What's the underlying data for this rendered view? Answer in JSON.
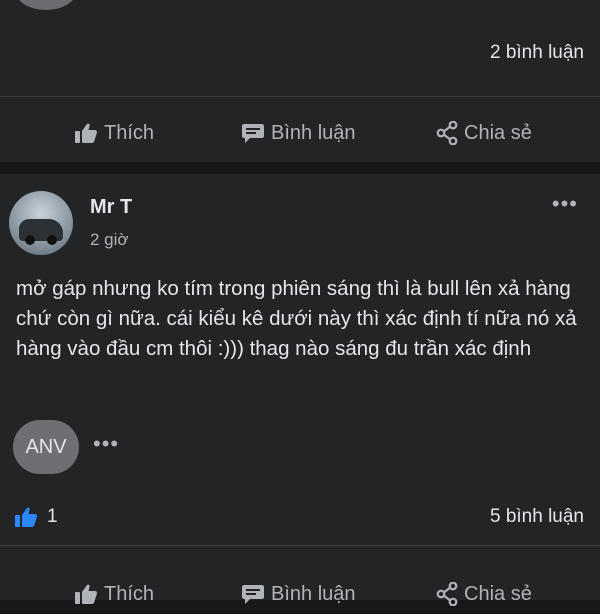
{
  "previous_post": {
    "comments_count": "2 bình luận",
    "actions": {
      "like_label": "Thích",
      "comment_label": "Bình luận",
      "share_label": "Chia sẻ"
    }
  },
  "post": {
    "author": "Mr T",
    "time": "2 giờ",
    "text": "mở gáp nhưng ko tím trong phiên sáng thì là bull lên xả hàng chứ còn gì nữa.  cái kiểu kê dưới này thì xác định tí nữa nó xả hàng vào đầu cm thôi :))) thag nào sáng đu trần xác định",
    "commenter_initials": "ANV",
    "like_count": "1",
    "comments_count": "5 bình luận",
    "actions": {
      "like_label": "Thích",
      "comment_label": "Bình luận",
      "share_label": "Chia sẻ"
    },
    "more_icon": "ellipsis-icon"
  },
  "colors": {
    "background": "#17181a",
    "card": "#232426",
    "accent_like": "#2d88ff",
    "muted_text": "#b0b3b8"
  }
}
